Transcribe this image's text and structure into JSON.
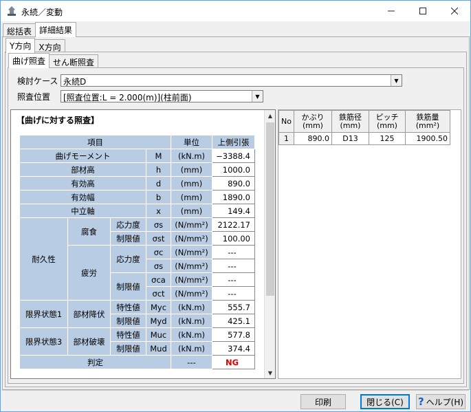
{
  "window": {
    "title": "永続／変動",
    "minimize_icon": "minimize-icon",
    "maximize_icon": "maximize-icon",
    "close_icon": "close-icon"
  },
  "tabs_top": [
    "総括表",
    "詳細結果"
  ],
  "tabs_dir": [
    "Y方向",
    "X方向"
  ],
  "tabs_check": [
    "曲げ照査",
    "せん断照査"
  ],
  "case": {
    "label": "検討ケース",
    "value": "永続D"
  },
  "position": {
    "label": "照査位置",
    "value": "[照査位置:L = 2.000(m)](柱前面)"
  },
  "heading": "【曲げに対する照査】",
  "table": {
    "h_item": "項目",
    "h_unit": "単位",
    "h_val": "上側引張",
    "r1": {
      "name": "曲げモーメント",
      "sym": "M",
      "unit": "(kN.m)",
      "val": "−3388.4"
    },
    "r2": {
      "name": "部材高",
      "sym": "h",
      "unit": "(mm)",
      "val": "1000.0"
    },
    "r3": {
      "name": "有効高",
      "sym": "d",
      "unit": "(mm)",
      "val": "890.0"
    },
    "r4": {
      "name": "有効幅",
      "sym": "b",
      "unit": "(mm)",
      "val": "1890.0"
    },
    "r5": {
      "name": "中立軸",
      "sym": "x",
      "unit": "(mm)",
      "val": "149.4"
    },
    "dur": "耐久性",
    "corr": "腐食",
    "fat": "疲労",
    "stress": "応力度",
    "limit": "制限値",
    "stress2": "応力度",
    "limit2": "制限値",
    "s_s": {
      "sym": "σs",
      "unit": "(N/mm²)",
      "val": "2122.17"
    },
    "s_st": {
      "sym": "σst",
      "unit": "(N/mm²)",
      "val": "100.00"
    },
    "s_c": {
      "sym": "σc",
      "unit": "(N/mm²)",
      "val": "---"
    },
    "s_s2": {
      "sym": "σs",
      "unit": "(N/mm²)",
      "val": "---"
    },
    "s_ca": {
      "sym": "σca",
      "unit": "(N/mm²)",
      "val": "---"
    },
    "s_ct": {
      "sym": "σct",
      "unit": "(N/mm²)",
      "val": "---"
    },
    "ls1": "限界状態1",
    "yield": "部材降伏",
    "char1": "特性値",
    "lim1": "制限値",
    "myc": {
      "sym": "Myc",
      "unit": "(kN.m)",
      "val": "555.7"
    },
    "myd": {
      "sym": "Myd",
      "unit": "(kN.m)",
      "val": "425.1"
    },
    "ls3": "限界状態3",
    "fail": "部材破壊",
    "char3": "特性値",
    "lim3": "制限値",
    "muc": {
      "sym": "Muc",
      "unit": "(kN.m)",
      "val": "577.8"
    },
    "mud": {
      "sym": "Mud",
      "unit": "(kN.m)",
      "val": "374.4"
    },
    "judge": "判定",
    "judge_unit": "---",
    "judge_val": "NG"
  },
  "grid": {
    "h_no": "No",
    "h_cover": "かぶり",
    "h_cover_u": "(mm)",
    "h_dia": "鉄筋径",
    "h_dia_u": "(mm)",
    "h_pitch": "ピッチ",
    "h_pitch_u": "(mm)",
    "h_area": "鉄筋量",
    "h_area_u": "(mm²)",
    "row": {
      "no": "1",
      "cover": "890.0",
      "dia": "D13",
      "pitch": "125",
      "area": "1900.50"
    }
  },
  "buttons": {
    "print": "印刷",
    "close": "閉じる(C)",
    "help": "ヘルプ(H)",
    "help_icon": "help-icon"
  }
}
